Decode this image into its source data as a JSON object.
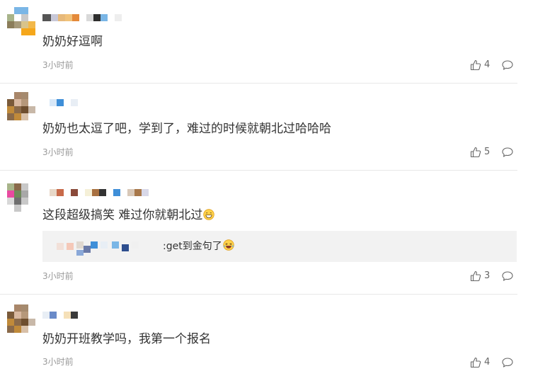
{
  "comments": [
    {
      "text": "奶奶好逗啊",
      "time": "3小时前",
      "likes": "4"
    },
    {
      "text": "奶奶也太逗了吧，学到了，难过的时候就朝北过哈哈哈",
      "time": "3小时前",
      "likes": "5"
    },
    {
      "text": "这段超级搞笑 难过你就朝北过",
      "emoji": "grin-emoji",
      "time": "3小时前",
      "likes": "3",
      "reply": {
        "text": ":get到金句了",
        "emoji": "laughing-tears-emoji"
      }
    },
    {
      "text": "奶奶开班教学吗，我第一个报名",
      "time": "3小时前",
      "likes": "4"
    }
  ],
  "icons": {
    "like": "thumbs-up-icon",
    "reply": "speech-bubble-icon"
  },
  "colors": {
    "text": "#333333",
    "meta": "#999999",
    "divider": "#e8e8e8",
    "reply_bg": "#f2f2f2"
  }
}
